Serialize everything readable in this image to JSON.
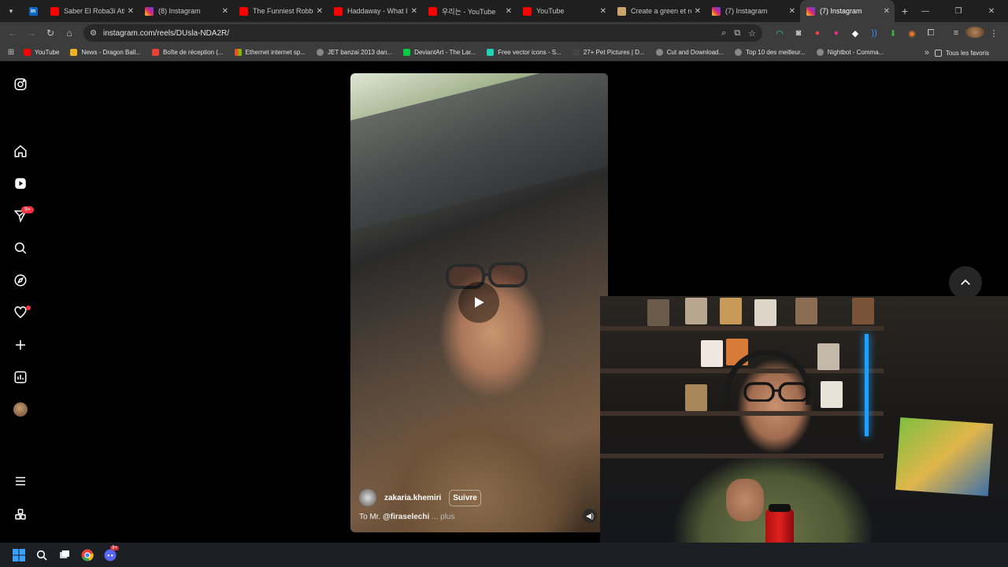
{
  "browser": {
    "tabs": [
      {
        "title": "Saber El Roba3i Athe",
        "favicon": "youtube-icon"
      },
      {
        "title": "(8) Instagram",
        "favicon": "instagram-icon"
      },
      {
        "title": "The Funniest Robbe",
        "favicon": "youtube-icon"
      },
      {
        "title": "Haddaway - What Is",
        "favicon": "youtube-icon"
      },
      {
        "title": "우리는 - YouTube",
        "favicon": "youtube-icon"
      },
      {
        "title": "YouTube",
        "favicon": "youtube-icon"
      },
      {
        "title": "Create a green et re",
        "favicon": "document-icon"
      },
      {
        "title": "(7) Instagram",
        "favicon": "instagram-icon"
      },
      {
        "title": "(7) Instagram",
        "favicon": "instagram-icon",
        "active": true
      }
    ],
    "url": "instagram.com/reels/DUsla-NDA2R/",
    "bookmarks": [
      "YouTube",
      "News - Dragon Ball...",
      "Boîte de réception (...",
      "Ethernet internet sp...",
      "JET banzai 2013 dan...",
      "DeviantArt - The Lar...",
      "Free vector icons - S...",
      "27+ Pet Pictures | D...",
      "Cut and Download...",
      "Top 10 des meilleur...",
      "Nightbot - Comma..."
    ],
    "all_bookmarks_label": "Tous les favoris"
  },
  "instagram": {
    "notification_badge": "9+",
    "reel": {
      "username": "zakaria.khemiri",
      "follow_label": "Suivre",
      "caption_prefix": "To Mr.",
      "caption_mention": "@firaselechi",
      "caption_more": "... plus"
    }
  },
  "taskbar": {
    "discord_badge": "9+"
  },
  "colors": {
    "accent": "#ff3040",
    "background": "#000000",
    "chrome_bar": "#3c3c3c",
    "tabstrip": "#1f1f1f"
  }
}
